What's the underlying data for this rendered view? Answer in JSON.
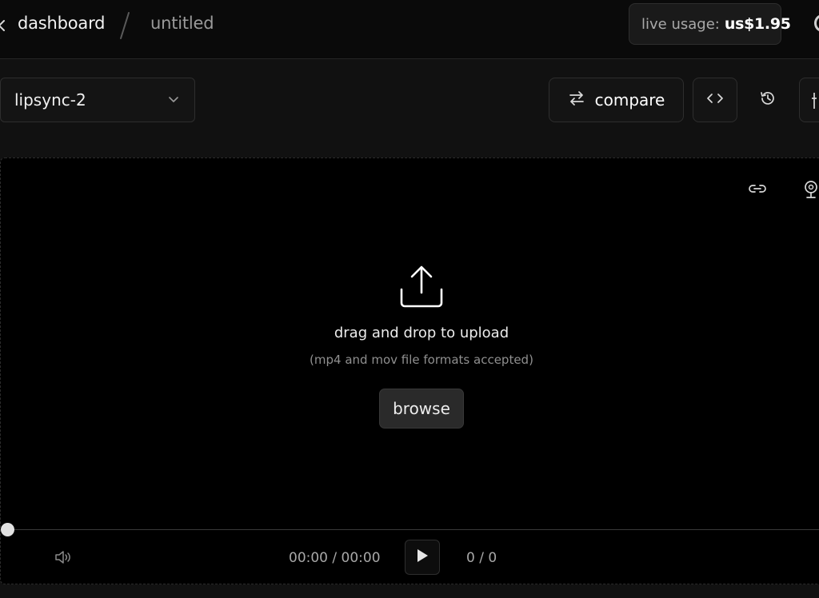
{
  "header": {
    "breadcrumb_home": "dashboard",
    "breadcrumb_page": "untitled",
    "usage_label": "live usage:",
    "usage_value": "us$1.95"
  },
  "toolbar": {
    "model_selected": "lipsync-2",
    "compare_label": "compare"
  },
  "upload": {
    "title": "drag and drop to upload",
    "hint": "(mp4 and mov file formats accepted)",
    "browse_label": "browse"
  },
  "player": {
    "time": "00:00 / 00:00",
    "frames": "0 / 0",
    "progress": 0
  },
  "icons": [
    "back-chevron-icon",
    "chevron-down-icon",
    "swap-arrows-icon",
    "code-icon",
    "history-icon",
    "sliders-icon",
    "link-icon",
    "webcam-icon",
    "upload-icon",
    "volume-icon",
    "play-icon"
  ],
  "colors": {
    "background": "#111111",
    "stage": "#000000",
    "border": "#2e2e2e",
    "text": "#ffffff",
    "muted": "#9a9a9a"
  }
}
